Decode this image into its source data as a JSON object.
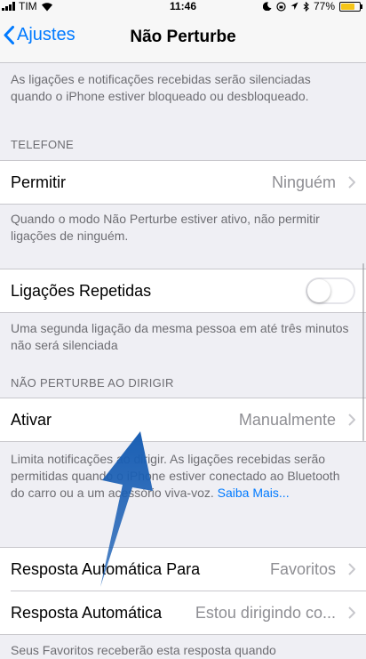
{
  "status_bar": {
    "carrier": "TIM",
    "time": "11:46",
    "battery": "77%",
    "battery_color": "#f5c518"
  },
  "nav": {
    "back_label": "Ajustes",
    "title": "Não Perturbe"
  },
  "intro_footer": "As ligações e notificações recebidas serão silenciadas quando o iPhone estiver bloqueado ou desbloqueado.",
  "telefone": {
    "header": "TELEFONE",
    "permitir_label": "Permitir",
    "permitir_value": "Ninguém",
    "permitir_footer": "Quando o modo Não Perturbe estiver ativo, não permitir ligações de ninguém.",
    "repetidas_label": "Ligações Repetidas",
    "repetidas_on": false,
    "repetidas_footer": "Uma segunda ligação da mesma pessoa em até três minutos não será silenciada"
  },
  "dirigir": {
    "header": "NÃO PERTURBE AO DIRIGIR",
    "ativar_label": "Ativar",
    "ativar_value": "Manualmente",
    "footer": "Limita notificações ao dirigir. As ligações recebidas serão permitidas quando o iPhone estiver conectado ao Bluetooth do carro ou a um acessório viva-voz.",
    "footer_link": "Saiba Mais..."
  },
  "resposta": {
    "para_label": "Resposta Automática Para",
    "para_value": "Favoritos",
    "auto_label": "Resposta Automática",
    "auto_value": "Estou dirigindo co...",
    "footer": "Seus Favoritos receberão esta resposta quando"
  },
  "accent_color": "#007aff",
  "annotation_arrow_color": "#1a5fb4"
}
